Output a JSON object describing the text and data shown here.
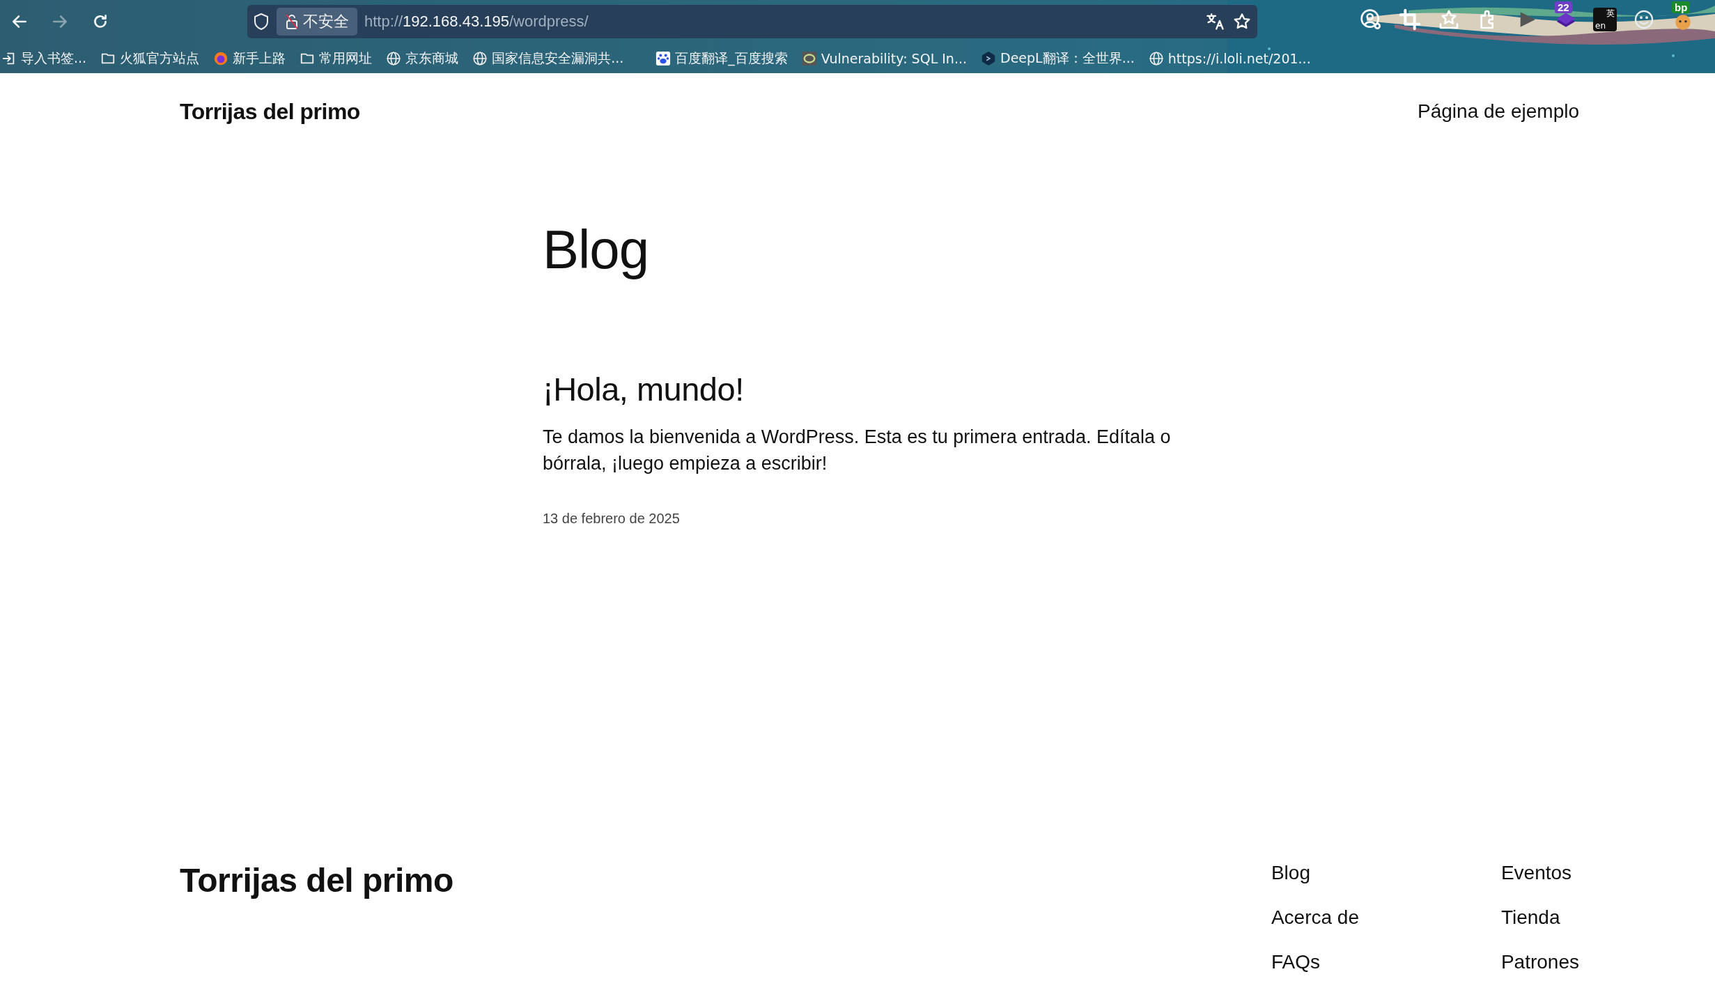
{
  "browser": {
    "nav_buttons": [
      {
        "kind": "back",
        "disabled": false
      },
      {
        "kind": "forward",
        "disabled": true
      },
      {
        "kind": "reload",
        "disabled": false
      }
    ],
    "security_label": "不安全",
    "url": {
      "scheme": "http://",
      "host": "192.168.43.195",
      "path": "/wordpress/"
    },
    "bookmarks": [
      {
        "kind": "import",
        "label": "导入书签..."
      },
      {
        "kind": "folder",
        "label": "火狐官方站点"
      },
      {
        "kind": "firefox",
        "label": "新手上路"
      },
      {
        "kind": "folder",
        "label": "常用网址"
      },
      {
        "kind": "globe",
        "label": "京东商城"
      },
      {
        "kind": "globe",
        "label": "国家信息安全漏洞共..."
      },
      {
        "kind": "paw",
        "label": "百度翻译_百度搜索"
      },
      {
        "kind": "ring",
        "label": "Vulnerability: SQL In..."
      },
      {
        "kind": "deepl",
        "label": "DeepL翻译：全世界..."
      },
      {
        "kind": "globe",
        "label": "https://i.loli.net/201..."
      }
    ],
    "extensions": [
      {
        "kind": "account"
      },
      {
        "kind": "crop"
      },
      {
        "kind": "star-tray"
      },
      {
        "kind": "puzzle"
      },
      {
        "kind": "play"
      },
      {
        "kind": "layers",
        "badge": "22"
      },
      {
        "kind": "translate",
        "top": "英",
        "bottom": "en"
      },
      {
        "kind": "smiley"
      },
      {
        "kind": "tag",
        "badge": "bp"
      }
    ]
  },
  "site": {
    "title": "Torrijas del primo",
    "nav": [
      "Página de ejemplo"
    ]
  },
  "page_title": "Blog",
  "posts": [
    {
      "title": "¡Hola, mundo!",
      "excerpt": "Te damos la bienvenida a WordPress. Esta es tu primera entrada. Edítala o bórrala, ¡luego empieza a escribir!",
      "date": "13 de febrero de 2025"
    }
  ],
  "footer": {
    "title": "Torrijas del primo",
    "links": [
      [
        "Blog",
        "Acerca de",
        "FAQs"
      ],
      [
        "Eventos",
        "Tienda",
        "Patrones"
      ]
    ]
  }
}
